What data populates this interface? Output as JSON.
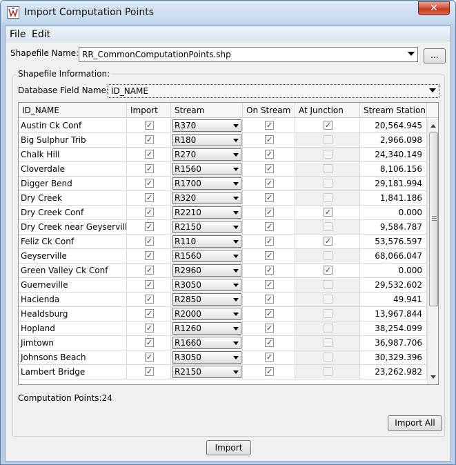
{
  "window": {
    "title": "Import Computation Points",
    "close_label": "✕"
  },
  "menu": {
    "file": "File",
    "edit": "Edit"
  },
  "shapefile": {
    "label": "Shapefile Name:",
    "value": "RR_CommonComputationPoints.shp",
    "browse_label": "..."
  },
  "info": {
    "group_label": "Shapefile Information:",
    "db_field_label": "Database Field Name:",
    "db_field_value": "ID_NAME"
  },
  "table": {
    "columns": [
      "ID_NAME",
      "Import",
      "Stream",
      "On Stream",
      "At Junction",
      "Stream Station"
    ],
    "rows": [
      {
        "name": "Austin Ck Conf",
        "import": true,
        "stream": "R370",
        "on_stream": true,
        "at_junction": true,
        "junction_enabled": true,
        "station": "20,564.945"
      },
      {
        "name": "Big Sulphur Trib",
        "import": true,
        "stream": "R180",
        "on_stream": true,
        "at_junction": false,
        "junction_enabled": false,
        "station": "2,966.098"
      },
      {
        "name": "Chalk Hill",
        "import": true,
        "stream": "R270",
        "on_stream": true,
        "at_junction": false,
        "junction_enabled": false,
        "station": "24,340.149"
      },
      {
        "name": "Cloverdale",
        "import": true,
        "stream": "R1560",
        "on_stream": true,
        "at_junction": false,
        "junction_enabled": false,
        "station": "8,106.156"
      },
      {
        "name": "Digger Bend",
        "import": true,
        "stream": "R1700",
        "on_stream": true,
        "at_junction": false,
        "junction_enabled": false,
        "station": "29,181.994"
      },
      {
        "name": "Dry Creek",
        "import": true,
        "stream": "R320",
        "on_stream": true,
        "at_junction": false,
        "junction_enabled": false,
        "station": "1,841.186"
      },
      {
        "name": "Dry Creek Conf",
        "import": true,
        "stream": "R2210",
        "on_stream": true,
        "at_junction": true,
        "junction_enabled": true,
        "station": "0.000"
      },
      {
        "name": "Dry Creek near Geyserville",
        "import": true,
        "stream": "R2150",
        "on_stream": true,
        "at_junction": false,
        "junction_enabled": false,
        "station": "9,584.787"
      },
      {
        "name": "Feliz Ck Conf",
        "import": true,
        "stream": "R110",
        "on_stream": true,
        "at_junction": true,
        "junction_enabled": true,
        "station": "53,576.597"
      },
      {
        "name": "Geyserville",
        "import": true,
        "stream": "R1560",
        "on_stream": true,
        "at_junction": false,
        "junction_enabled": false,
        "station": "68,066.047"
      },
      {
        "name": "Green Valley Ck Conf",
        "import": true,
        "stream": "R2960",
        "on_stream": true,
        "at_junction": true,
        "junction_enabled": true,
        "station": "0.000"
      },
      {
        "name": "Guerneville",
        "import": true,
        "stream": "R3050",
        "on_stream": true,
        "at_junction": false,
        "junction_enabled": false,
        "station": "29,532.602"
      },
      {
        "name": "Hacienda",
        "import": true,
        "stream": "R2850",
        "on_stream": true,
        "at_junction": false,
        "junction_enabled": false,
        "station": "49.941"
      },
      {
        "name": "Healdsburg",
        "import": true,
        "stream": "R2000",
        "on_stream": true,
        "at_junction": false,
        "junction_enabled": false,
        "station": "13,967.844"
      },
      {
        "name": "Hopland",
        "import": true,
        "stream": "R1260",
        "on_stream": true,
        "at_junction": false,
        "junction_enabled": false,
        "station": "38,254.099"
      },
      {
        "name": "Jimtown",
        "import": true,
        "stream": "R1660",
        "on_stream": true,
        "at_junction": false,
        "junction_enabled": false,
        "station": "36,987.706"
      },
      {
        "name": "Johnsons Beach",
        "import": true,
        "stream": "R3050",
        "on_stream": true,
        "at_junction": false,
        "junction_enabled": false,
        "station": "30,329.396"
      },
      {
        "name": "Lambert Bridge",
        "import": true,
        "stream": "R2150",
        "on_stream": true,
        "at_junction": false,
        "junction_enabled": false,
        "station": "23,262.982"
      }
    ]
  },
  "footer": {
    "count_label": "Computation Points:24",
    "import_all_label": "Import All",
    "import_label": "Import"
  },
  "colors": {
    "accent": "#c23a1f",
    "frame": "#b9cfe8",
    "check": "#2a3f7a"
  }
}
